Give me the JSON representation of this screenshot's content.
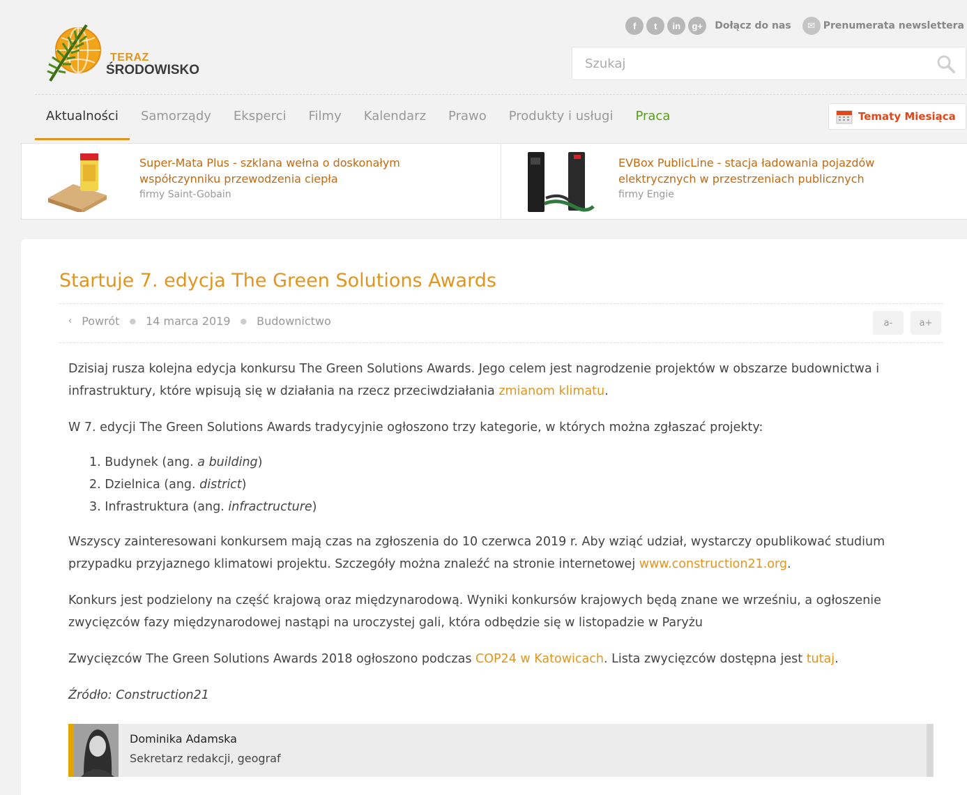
{
  "header": {
    "logo_line1": "TERAZ",
    "logo_line2": "ŚRODOWISKO",
    "social_icons": [
      "facebook-icon",
      "twitter-icon",
      "linkedin-icon",
      "google-plus-icon"
    ],
    "join_label": "Dołącz do nas",
    "newsletter_label": "Prenumerata newslettera",
    "search_placeholder": "Szukaj",
    "accent": "#e2951d"
  },
  "nav": {
    "items": [
      {
        "label": "Aktualności"
      },
      {
        "label": "Samorządy"
      },
      {
        "label": "Eksperci"
      },
      {
        "label": "Filmy"
      },
      {
        "label": "Kalendarz"
      },
      {
        "label": "Prawo"
      },
      {
        "label": "Produkty i usługi"
      },
      {
        "label": "Praca"
      }
    ],
    "tematy_label": "Tematy Miesiąca"
  },
  "products": [
    {
      "title_line1": "Super-Mata Plus - szklana wełna o doskonałym",
      "title_line2": "współczynniku przewodzenia ciepła",
      "firm": "firmy Saint-Gobain"
    },
    {
      "title_line1": "EVBox PublicLine - stacja ładowania pojazdów",
      "title_line2": "elektrycznych w przestrzeniach publicznych",
      "firm": "firmy Engie"
    }
  ],
  "article": {
    "title": "Startuje 7. edycja The Green Solutions Awards",
    "back_label": "Powrót",
    "date": "14 marca 2019",
    "category": "Budownictwo",
    "font_minus": "a-",
    "font_plus": "a+",
    "p1_a": "Dzisiaj rusza kolejna edycja konkursu The Green Solutions Awards. Jego celem jest nagrodzenie projektów w obszarze budownictwa i infrastruktury, które wpisują się w działania na rzecz przeciwdziałania ",
    "p1_link": "zmianom klimatu",
    "p1_end": ".",
    "p2": "W 7. edycji The Green Solutions Awards tradycyjnie ogłoszono trzy kategorie, w których można zgłaszać projekty:",
    "list": [
      {
        "num": "1.",
        "text": "Budynek (ang. ",
        "em": "a building",
        "close": ")"
      },
      {
        "num": "2.",
        "text": "Dzielnica (ang. ",
        "em": "district",
        "close": ")"
      },
      {
        "num": "3.",
        "text": "Infrastruktura (ang. ",
        "em": "infractructure",
        "close": ")"
      }
    ],
    "p3_a": "Wszyscy zainteresowani konkursem mają czas na zgłoszenia do 10 czerwca 2019 r. Aby wziąć udział, wystarczy opublikować studium przypadku przyjaznego klimatowi projektu. Szczegóły można znaleźć na stronie internetowej ",
    "p3_link": "www.construction21.org",
    "p3_end": ".",
    "p4": "Konkurs jest podzielony na część krajową oraz międzynarodową. Wyniki konkursów krajowych będą znane we wrześniu, a ogłoszenie zwycięzców fazy międzynarodowej nastąpi na uroczystej gali, która odbędzie się w listopadzie w Paryżu",
    "p5_a": "Zwycięzców The Green Solutions Awards 2018 ogłoszono podczas ",
    "p5_link1": "COP24 w Katowicach",
    "p5_b": ". Lista zwycięzców dostępna jest ",
    "p5_link2": "tutaj",
    "p5_end": ".",
    "source": "Źródło: Construction21"
  },
  "author": {
    "name": "Dominika Adamska",
    "role": "Sekretarz redakcji, geograf"
  }
}
